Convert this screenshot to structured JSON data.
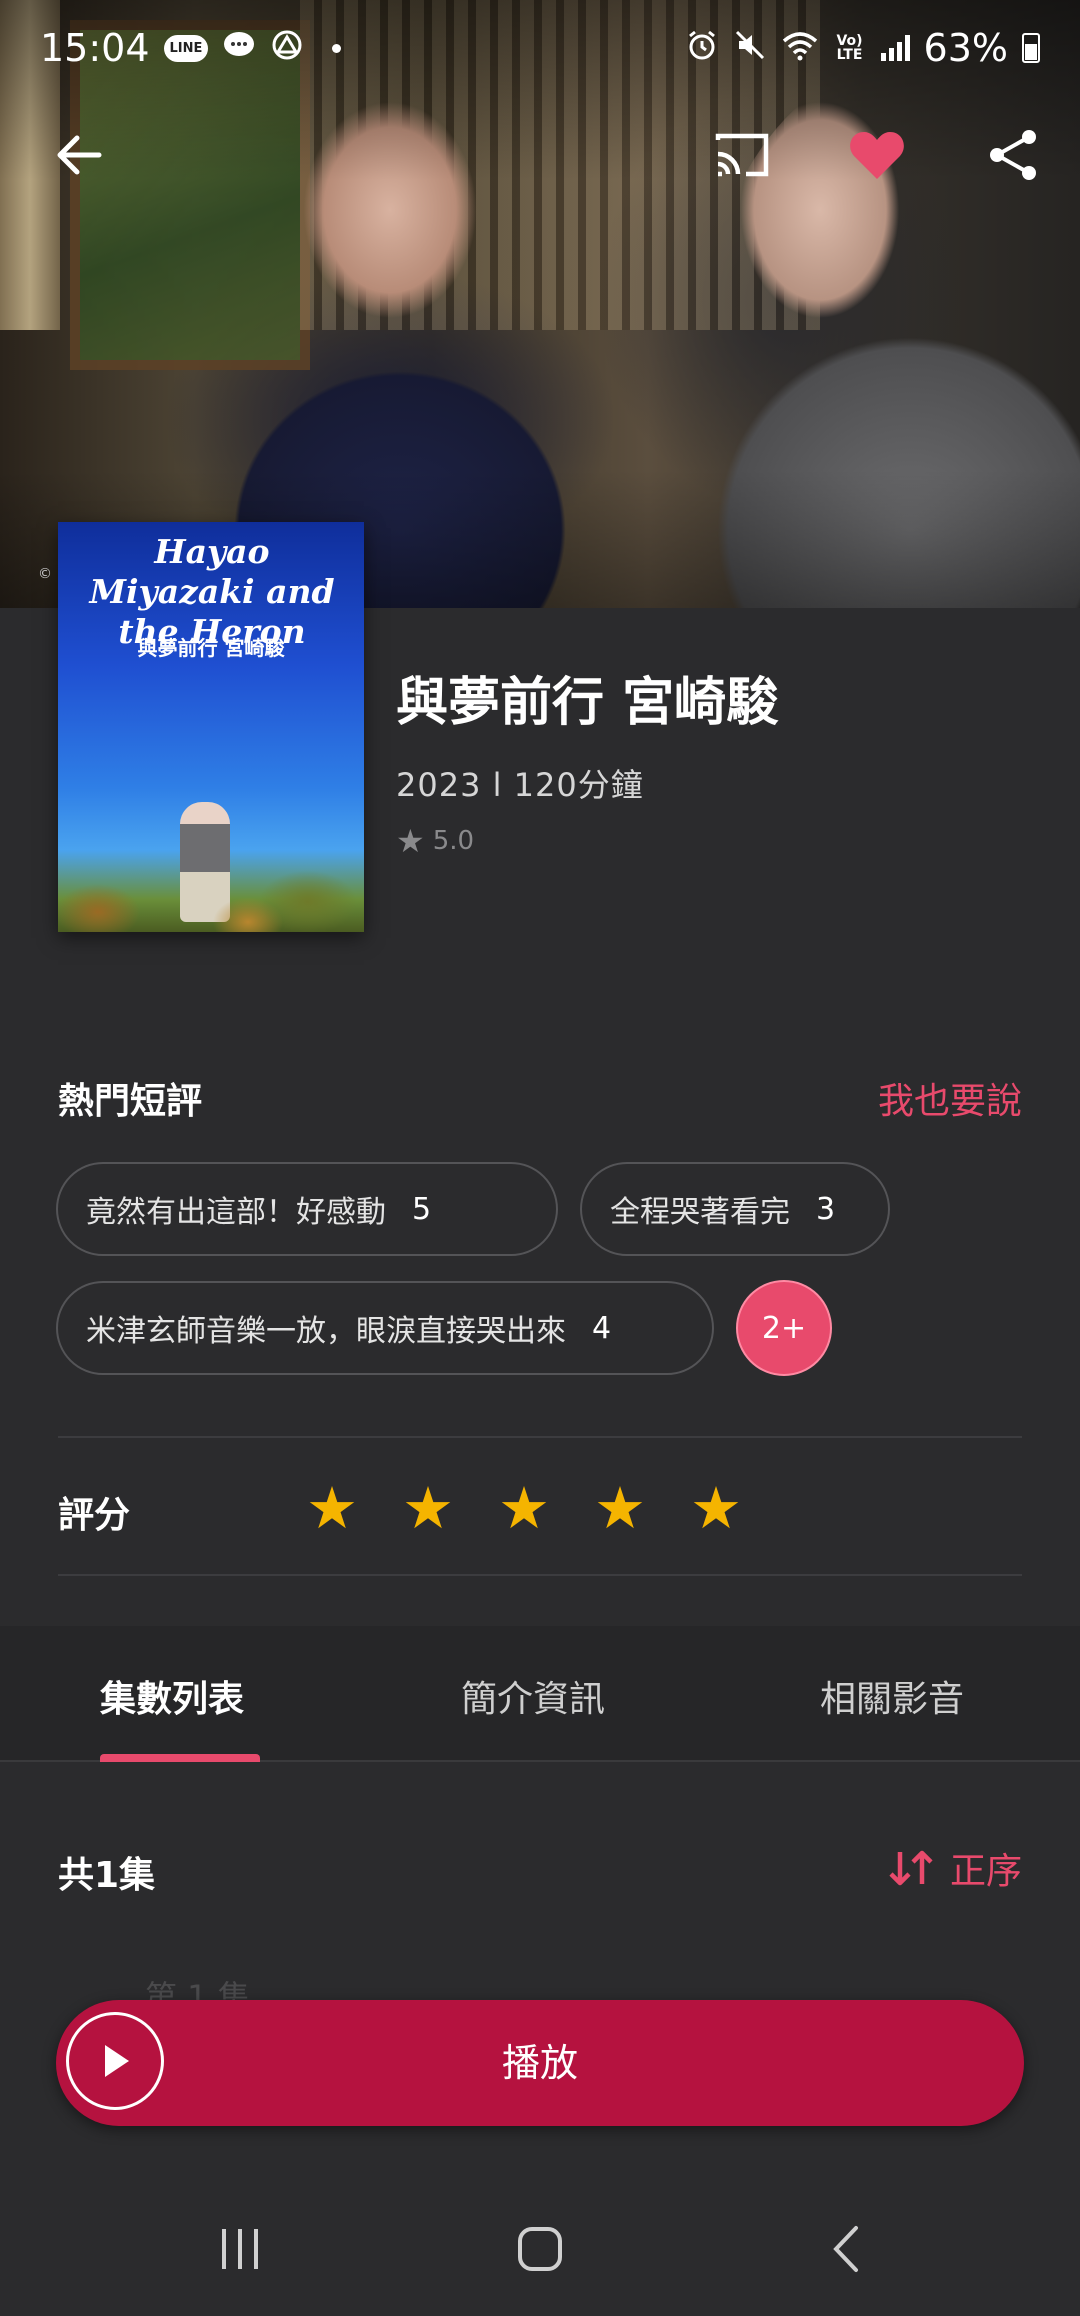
{
  "status_bar": {
    "time": "15:04",
    "notif_line": "LINE",
    "battery_percent": "63%",
    "network_label": "Vo) LTE"
  },
  "movie": {
    "poster_title": "Hayao Miyazaki and the Heron",
    "poster_subtitle": "與夢前行 宮崎駿",
    "title": "與夢前行 宮崎駿",
    "meta": "2023 l 120分鐘",
    "rating": "5.0",
    "copyright": "©"
  },
  "hot_comments": {
    "title": "熱門短評",
    "add_link": "我也要說",
    "chips": [
      {
        "text": "竟然有出這部！好感動",
        "count": "5"
      },
      {
        "text": "全程哭著看完",
        "count": "3"
      },
      {
        "text": "米津玄師音樂一放，眼淚直接哭出來",
        "count": "4"
      }
    ],
    "more_label": "2+"
  },
  "score": {
    "label": "評分",
    "stars": [
      "★",
      "★",
      "★",
      "★",
      "★"
    ]
  },
  "tabs": [
    {
      "label": "集數列表",
      "active": true
    },
    {
      "label": "簡介資訊",
      "active": false
    },
    {
      "label": "相關影音",
      "active": false
    }
  ],
  "episodes": {
    "count_label": "共1集",
    "sort_label": "正序",
    "peek_label": "第 1 集"
  },
  "play_button": {
    "label": "播放"
  },
  "colors": {
    "accent": "#e84a6c",
    "play_bar": "#b5123f",
    "star": "#f5b400",
    "background": "#2b2b2d"
  }
}
